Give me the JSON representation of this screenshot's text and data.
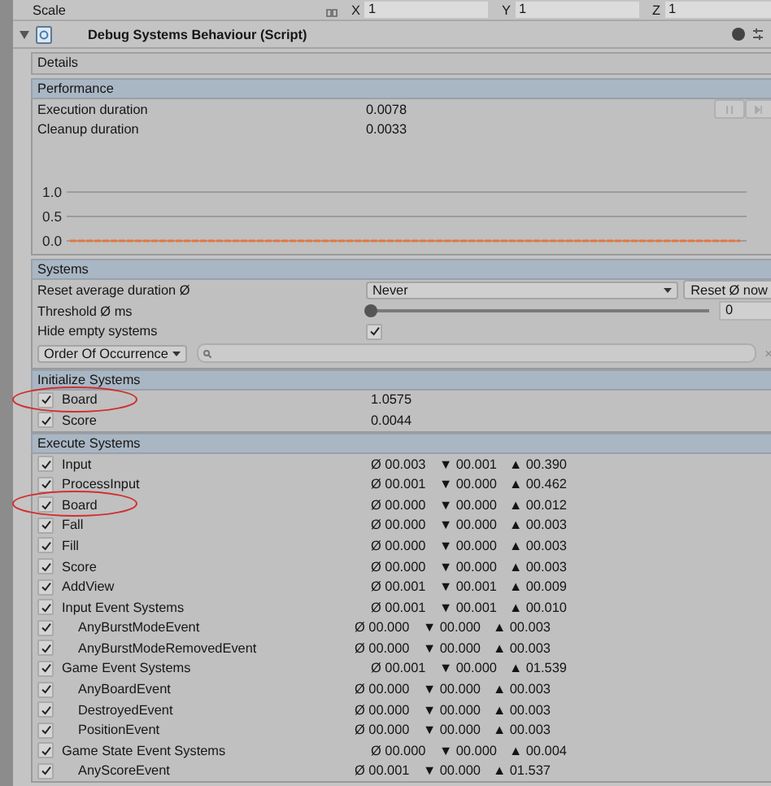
{
  "transform_row": {
    "label": "Scale",
    "fields": [
      {
        "axis": "X",
        "value": "1"
      },
      {
        "axis": "Y",
        "value": "1"
      },
      {
        "axis": "Z",
        "value": "1"
      }
    ]
  },
  "component": {
    "title": "Debug Systems Behaviour (Script)",
    "expanded": true
  },
  "details": {
    "label": "Details"
  },
  "performance": {
    "title": "Performance",
    "stats": [
      {
        "label": "Execution duration",
        "value": "0.0078"
      },
      {
        "label": "Cleanup duration",
        "value": "0.0033"
      }
    ],
    "chart_data": {
      "type": "line",
      "ylim": [
        0,
        1
      ],
      "yticks": [
        {
          "value": 0,
          "label": "0.0"
        },
        {
          "value": 0.5,
          "label": "0.5"
        },
        {
          "value": 1,
          "label": "1.0"
        }
      ],
      "series": [
        {
          "color": "#e8743a",
          "line_style": "dashed",
          "values": [
            0,
            0,
            0,
            0,
            0,
            0,
            0,
            0,
            0,
            0,
            0,
            0,
            0,
            0,
            0,
            0,
            0,
            0,
            0,
            0,
            0,
            0,
            0,
            0,
            0,
            0,
            0,
            0,
            0,
            0,
            0,
            0,
            0,
            0,
            0,
            0,
            0,
            0,
            0,
            0,
            0,
            0,
            0,
            0,
            0,
            0,
            0,
            0,
            0,
            0
          ]
        }
      ]
    }
  },
  "systems": {
    "title": "Systems",
    "reset": {
      "label": "Reset average duration Ø",
      "value": "Never",
      "button": "Reset Ø now"
    },
    "threshold": {
      "label": "Threshold Ø ms",
      "level": 0,
      "value": "0"
    },
    "hide_empty": {
      "label": "Hide empty systems",
      "checked": true
    },
    "order": {
      "value": "Order Of Occurrence"
    },
    "search": {
      "clear": "×"
    }
  },
  "initialize": {
    "title": "Initialize Systems",
    "rows": [
      {
        "name": "Board",
        "checked": true,
        "circled": true,
        "value": "1.0575"
      },
      {
        "name": "Score",
        "checked": true,
        "circled": false,
        "value": "0.0044"
      }
    ]
  },
  "execute": {
    "title": "Execute Systems",
    "rows": [
      {
        "name": "Input",
        "checked": true,
        "circled": false,
        "avg": "Ø 00.003",
        "min": "▼ 00.001",
        "max": "▲ 00.390"
      },
      {
        "name": "ProcessInput",
        "checked": true,
        "circled": false,
        "avg": "Ø 00.001",
        "min": "▼ 00.000",
        "max": "▲ 00.462"
      },
      {
        "name": "Board",
        "checked": true,
        "circled": true,
        "avg": "Ø 00.000",
        "min": "▼ 00.000",
        "max": "▲ 00.012"
      },
      {
        "name": "Fall",
        "checked": true,
        "circled": false,
        "avg": "Ø 00.000",
        "min": "▼ 00.000",
        "max": "▲ 00.003"
      },
      {
        "name": "Fill",
        "checked": true,
        "circled": false,
        "avg": "Ø 00.000",
        "min": "▼ 00.000",
        "max": "▲ 00.003"
      },
      {
        "name": "Score",
        "checked": true,
        "circled": false,
        "avg": "Ø 00.000",
        "min": "▼ 00.000",
        "max": "▲ 00.003"
      },
      {
        "name": "AddView",
        "checked": true,
        "circled": false,
        "avg": "Ø 00.001",
        "min": "▼ 00.001",
        "max": "▲ 00.009"
      },
      {
        "name": "Input Event Systems",
        "checked": true,
        "circled": false,
        "avg": "Ø 00.001",
        "min": "▼ 00.001",
        "max": "▲ 00.010",
        "children": [
          {
            "name": "AnyBurstModeEvent",
            "checked": true,
            "circled": false,
            "avg": "Ø 00.000",
            "min": "▼ 00.000",
            "max": "▲ 00.003"
          },
          {
            "name": "AnyBurstModeRemovedEvent",
            "checked": true,
            "circled": false,
            "avg": "Ø 00.000",
            "min": "▼ 00.000",
            "max": "▲ 00.003"
          }
        ]
      },
      {
        "name": "Game Event Systems",
        "checked": true,
        "circled": false,
        "avg": "Ø 00.001",
        "min": "▼ 00.000",
        "max": "▲ 01.539",
        "children": [
          {
            "name": "AnyBoardEvent",
            "checked": true,
            "circled": false,
            "avg": "Ø 00.000",
            "min": "▼ 00.000",
            "max": "▲ 00.003"
          },
          {
            "name": "DestroyedEvent",
            "checked": true,
            "circled": false,
            "avg": "Ø 00.000",
            "min": "▼ 00.000",
            "max": "▲ 00.003"
          },
          {
            "name": "PositionEvent",
            "checked": true,
            "circled": false,
            "avg": "Ø 00.000",
            "min": "▼ 00.000",
            "max": "▲ 00.003"
          }
        ]
      },
      {
        "name": "Game State Event Systems",
        "checked": true,
        "circled": false,
        "avg": "Ø 00.000",
        "min": "▼ 00.000",
        "max": "▲ 00.004",
        "children": [
          {
            "name": "AnyScoreEvent",
            "checked": true,
            "circled": false,
            "avg": "Ø 00.001",
            "min": "▼ 00.000",
            "max": "▲ 01.537"
          }
        ]
      }
    ]
  }
}
